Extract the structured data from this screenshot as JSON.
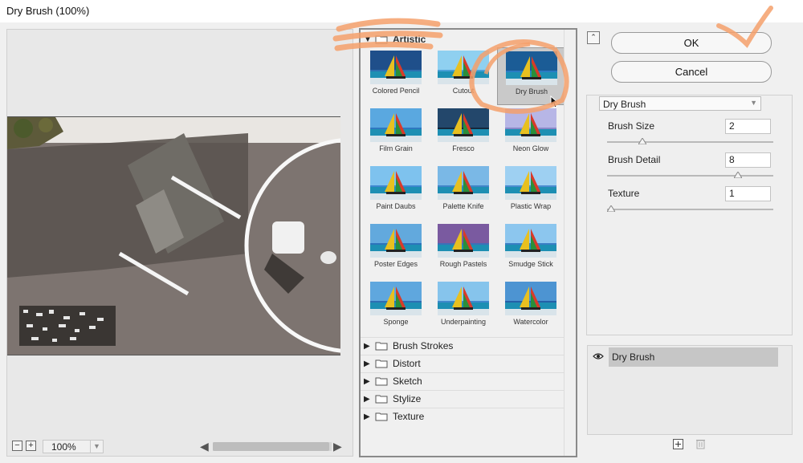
{
  "window": {
    "title": "Dry Brush (100%)"
  },
  "preview": {
    "zoom_value": "100%",
    "zoom_out_symbol": "−",
    "zoom_in_symbol": "+",
    "scroll_left_arrow": "◀",
    "scroll_right_arrow": "▶"
  },
  "gallery": {
    "open_category": "Artistic",
    "filters": [
      "Colored Pencil",
      "Cutout",
      "Dry Brush",
      "Film Grain",
      "Fresco",
      "Neon Glow",
      "Paint Daubs",
      "Palette Knife",
      "Plastic Wrap",
      "Poster Edges",
      "Rough Pastels",
      "Smudge Stick",
      "Sponge",
      "Underpainting",
      "Watercolor"
    ],
    "selected_filter": "Dry Brush",
    "collapsed_categories": [
      "Brush Strokes",
      "Distort",
      "Sketch",
      "Stylize",
      "Texture"
    ],
    "expanded_arrow": "▼",
    "collapsed_arrow": "▶"
  },
  "buttons": {
    "ok": "OK",
    "cancel": "Cancel",
    "collapse_symbol": "⌃"
  },
  "settings": {
    "filter_dropdown": "Dry Brush",
    "params": [
      {
        "label": "Brush Size",
        "value": "2",
        "min": 0,
        "max": 10,
        "level": 2
      },
      {
        "label": "Brush Detail",
        "value": "8",
        "min": 0,
        "max": 10,
        "level": 8
      },
      {
        "label": "Texture",
        "value": "1",
        "min": 1,
        "max": 3,
        "level": 1
      }
    ]
  },
  "layers": {
    "items": [
      "Dry Brush"
    ]
  },
  "colors": {
    "annotation": "#f4a06b",
    "selected_thumb": "#c9c9c9",
    "layer_selected": "#c6c6c6"
  },
  "icons": [
    "folder-icon",
    "eye-icon",
    "new-layer-icon",
    "trash-icon",
    "mouse-cursor-icon"
  ]
}
